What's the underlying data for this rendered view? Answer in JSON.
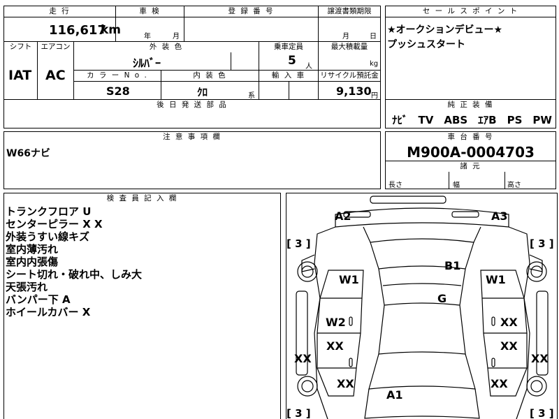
{
  "top_table": {
    "headers": {
      "mileage": "走 行",
      "inspection": "車 検",
      "registration": "登 録 番 号",
      "transfer_docs": "譲渡書類期限",
      "shift": "シフト",
      "aircon": "エアコン",
      "exterior_color": "外 装 色",
      "capacity": "乗車定員",
      "max_load": "最大積載量",
      "color_no": "カ ラ ー N o .",
      "interior_color": "内 装 色",
      "import": "輸 入 車",
      "recycle": "リサイクル預託金",
      "later_parts": "後 日 発 送 部 品"
    },
    "mileage_value": "116,617",
    "mileage_unit": "km",
    "inspection_year_label": "年",
    "inspection_month_label": "月",
    "transfer_month_label": "月",
    "transfer_day_label": "日",
    "shift_value": "IAT",
    "aircon_value": "AC",
    "exterior_color_value": "ｼﾙﾊﾞｰ",
    "capacity_value": "5",
    "capacity_unit": "人",
    "max_load_unit": "kg",
    "color_no_value": "S28",
    "interior_color_value": "ｸﾛ",
    "interior_suffix": "系",
    "recycle_value": "9,130",
    "recycle_unit": "円"
  },
  "sales_point": {
    "header": "セ ー ル ス ポ イ ン ト",
    "line1": "★オークションデビュー★",
    "line2": "プッシュスタート"
  },
  "equipment": {
    "header": "純 正 装 備",
    "value": "ﾅﾋﾞ　TV　ABS　ｴｱB　PS　PW"
  },
  "caution": {
    "header": "注 意 事 項 欄",
    "value": "W66ナビ"
  },
  "chassis": {
    "header": "車 台 番 号",
    "value": "M900A-0004703"
  },
  "dimensions": {
    "header": "諸 元",
    "length": "長さ",
    "width": "幅",
    "height": "高さ"
  },
  "inspector": {
    "header": "検 査 員 記 入 欄",
    "notes": [
      "トランクフロア U",
      "センターピラー X X",
      "外装うすい線キズ",
      "室内薄汚れ",
      "室内内張傷",
      "シート切れ・破れ中、しみ大",
      "天張汚れ",
      "バンパー下 A",
      "ホイールカバー X"
    ]
  },
  "diagram": {
    "marks": {
      "a2": "A2",
      "a3": "A3",
      "b1": "B1",
      "w1_left": "W1",
      "w1_right": "W1",
      "g": "G",
      "w2": "W2",
      "xx_right_upper": "XX",
      "xx_left_mid": "XX",
      "xx_right_mid": "XX",
      "xx_left_edge": "XX",
      "xx_right_edge": "XX",
      "xx_left_lower": "XX",
      "xx_right_lower": "XX",
      "a1": "A1"
    },
    "tire_left_top": "[ 3 ]",
    "tire_right_top": "[ 3 ]",
    "tire_left_bottom": "[ 3 ]",
    "tire_right_bottom": "[ 3 ]"
  }
}
